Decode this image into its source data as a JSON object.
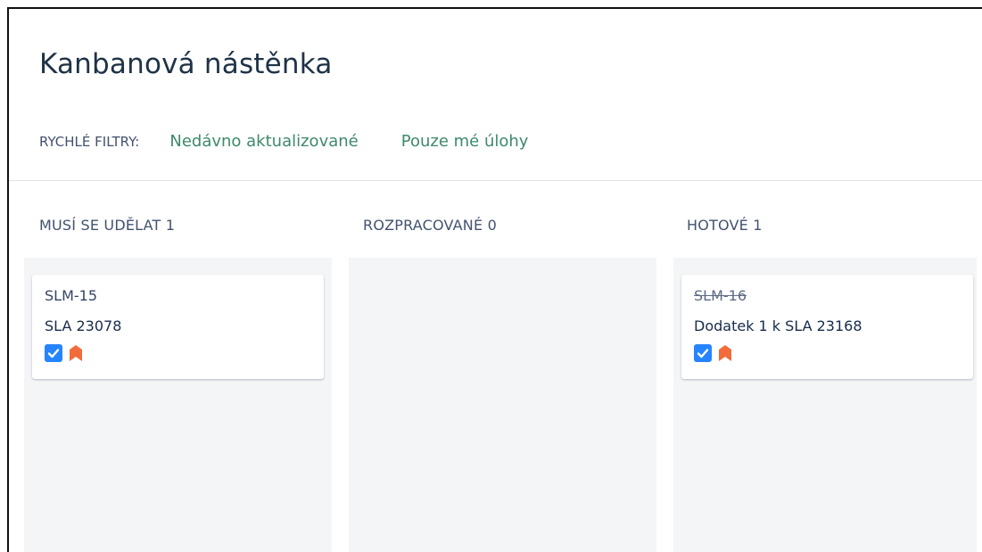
{
  "page": {
    "title": "Kanbanová nástěnka"
  },
  "quick_filters": {
    "label": "RYCHLÉ FILTRY:",
    "items": [
      "Nedávno aktualizované",
      "Pouze mé úlohy"
    ]
  },
  "columns": [
    {
      "header": "MUSÍ SE UDĚLAT 1",
      "cards": [
        {
          "key": "SLM-15",
          "summary": "SLA 23078",
          "done": false,
          "icons": [
            "task-check-icon",
            "priority-high-icon"
          ]
        }
      ]
    },
    {
      "header": "ROZPRACOVANÉ 0",
      "cards": []
    },
    {
      "header": "HOTOVÉ 1",
      "cards": [
        {
          "key": "SLM-16",
          "summary": "Dodatek 1 k SLA 23168",
          "done": true,
          "icons": [
            "task-check-icon",
            "priority-high-icon"
          ]
        }
      ]
    }
  ],
  "colors": {
    "title": "#1f3247",
    "filter_link": "#3d8a6a",
    "column_bg": "#f4f5f7",
    "task_icon": "#2684ff",
    "priority_icon": "#f26b3a"
  }
}
